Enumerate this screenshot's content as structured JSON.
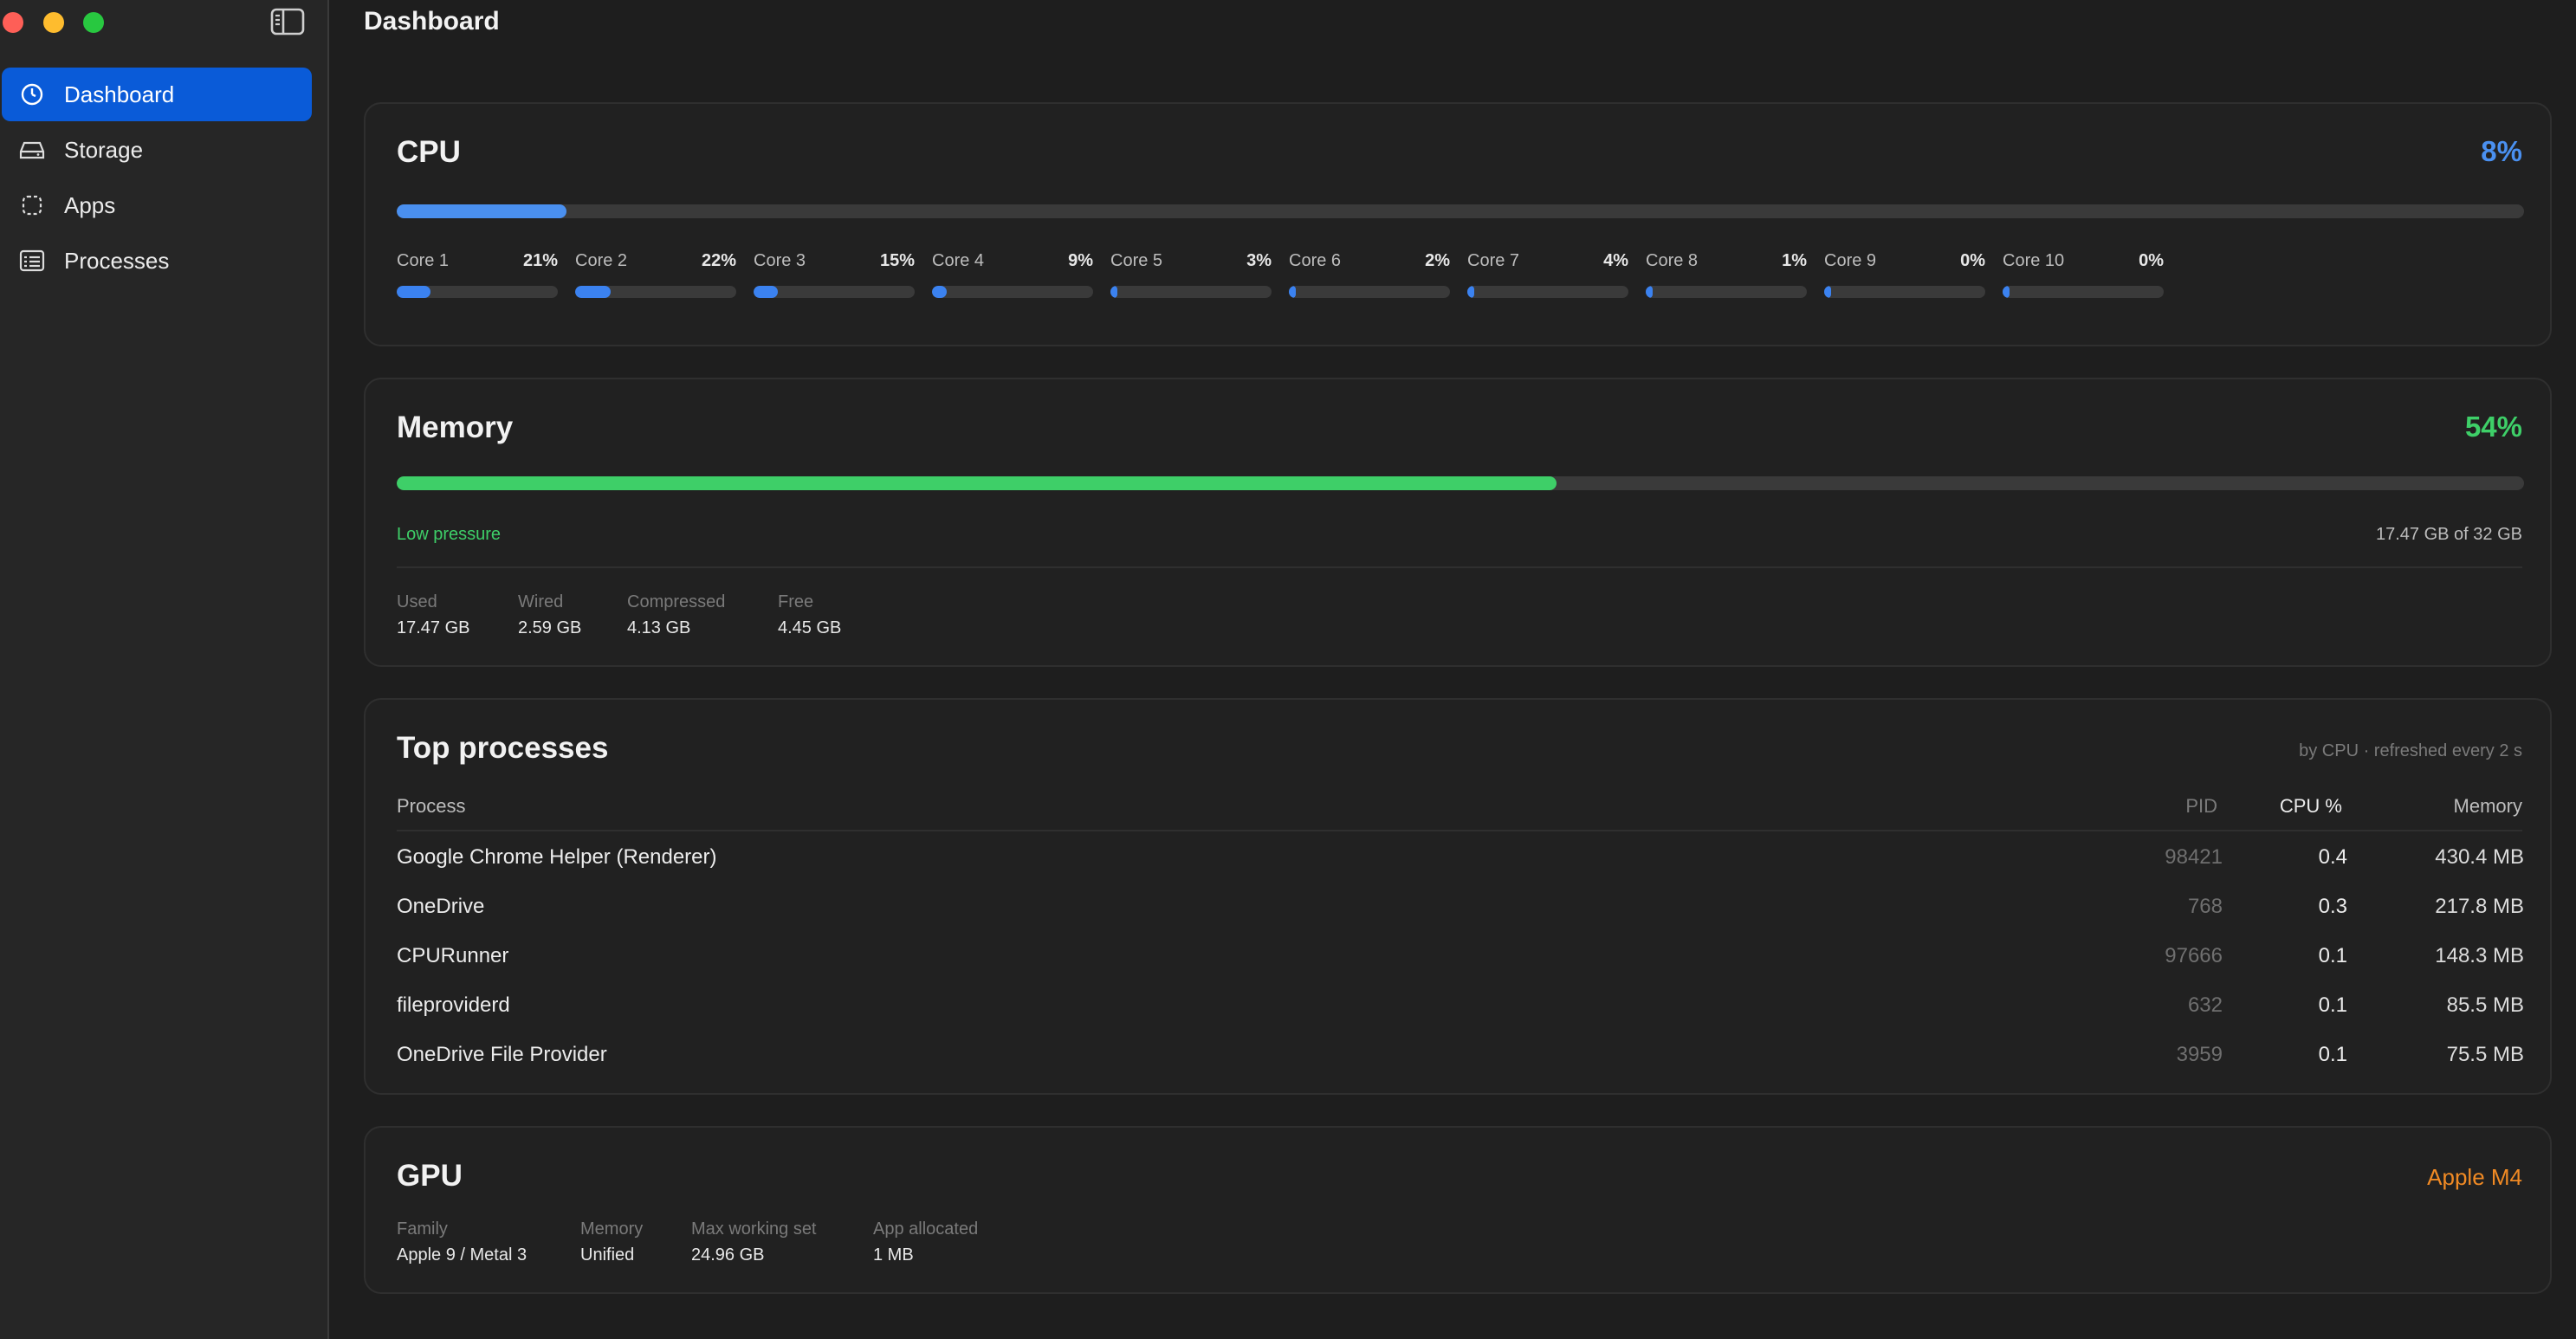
{
  "window": {
    "title": "Dashboard"
  },
  "sidebar": {
    "items": [
      {
        "label": "Dashboard",
        "icon": "gauge-icon",
        "active": true
      },
      {
        "label": "Storage",
        "icon": "drive-icon",
        "active": false
      },
      {
        "label": "Apps",
        "icon": "apps-icon",
        "active": false
      },
      {
        "label": "Processes",
        "icon": "list-icon",
        "active": false
      }
    ]
  },
  "cpu": {
    "title": "CPU",
    "total": "8%",
    "total_fraction": 0.08,
    "accent": "#4a90f0",
    "cores": [
      {
        "label": "Core 1",
        "value": "21%",
        "fraction": 0.21
      },
      {
        "label": "Core 2",
        "value": "22%",
        "fraction": 0.22
      },
      {
        "label": "Core 3",
        "value": "15%",
        "fraction": 0.15
      },
      {
        "label": "Core 4",
        "value": "9%",
        "fraction": 0.09
      },
      {
        "label": "Core 5",
        "value": "3%",
        "fraction": 0.03
      },
      {
        "label": "Core 6",
        "value": "2%",
        "fraction": 0.02
      },
      {
        "label": "Core 7",
        "value": "4%",
        "fraction": 0.04
      },
      {
        "label": "Core 8",
        "value": "1%",
        "fraction": 0.01
      },
      {
        "label": "Core 9",
        "value": "0%",
        "fraction": 0.0
      },
      {
        "label": "Core 10",
        "value": "0%",
        "fraction": 0.0
      }
    ]
  },
  "memory": {
    "title": "Memory",
    "total": "54%",
    "total_fraction": 0.545,
    "accent": "#3ecf68",
    "pressure": "Low pressure",
    "used_of_total": "17.47 GB of 32 GB",
    "stats": [
      {
        "label": "Used",
        "value": "17.47 GB"
      },
      {
        "label": "Wired",
        "value": "2.59 GB"
      },
      {
        "label": "Compressed",
        "value": "4.13 GB"
      },
      {
        "label": "Free",
        "value": "4.45 GB"
      }
    ]
  },
  "processes": {
    "title": "Top processes",
    "subtitle": "by CPU · refreshed every 2 s",
    "columns": {
      "process": "Process",
      "pid": "PID",
      "cpu": "CPU %",
      "memory": "Memory"
    },
    "rows": [
      {
        "name": "Google Chrome Helper (Renderer)",
        "pid": "98421",
        "cpu": "0.4",
        "memory": "430.4 MB"
      },
      {
        "name": "OneDrive",
        "pid": "768",
        "cpu": "0.3",
        "memory": "217.8 MB"
      },
      {
        "name": "CPURunner",
        "pid": "97666",
        "cpu": "0.1",
        "memory": "148.3 MB"
      },
      {
        "name": "fileproviderd",
        "pid": "632",
        "cpu": "0.1",
        "memory": "85.5 MB"
      },
      {
        "name": "OneDrive File Provider",
        "pid": "3959",
        "cpu": "0.1",
        "memory": "75.5 MB"
      }
    ]
  },
  "gpu": {
    "title": "GPU",
    "name": "Apple M4",
    "accent": "#f08a24",
    "stats": [
      {
        "label": "Family",
        "value": "Apple 9 / Metal 3"
      },
      {
        "label": "Memory",
        "value": "Unified"
      },
      {
        "label": "Max working set",
        "value": "24.96 GB"
      },
      {
        "label": "App allocated",
        "value": "1 MB"
      }
    ]
  }
}
